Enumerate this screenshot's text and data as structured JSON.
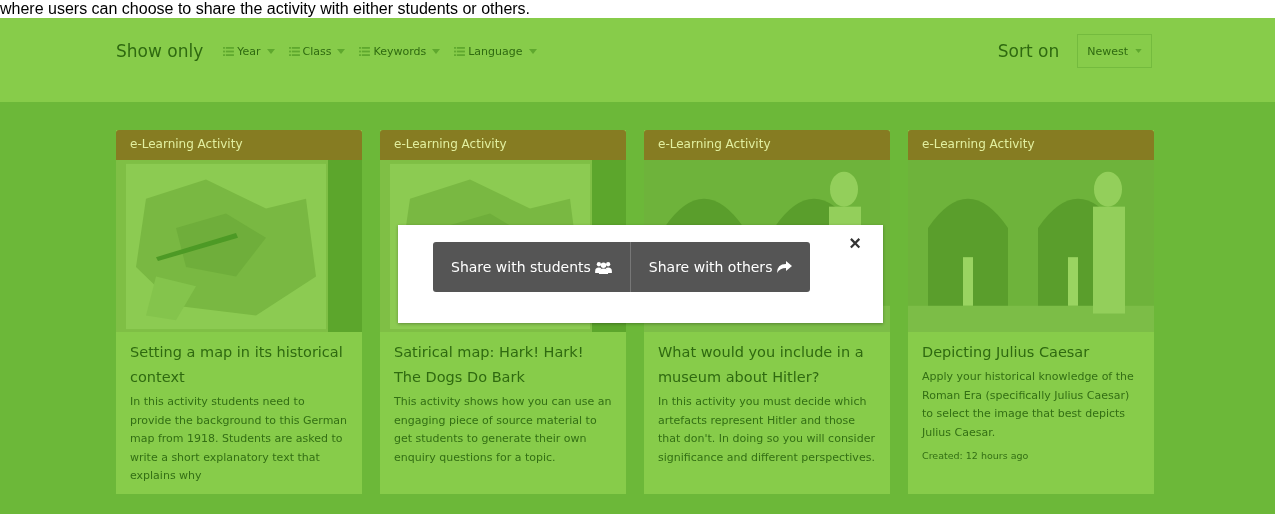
{
  "caption": "where users can choose to share the activity with either students or others.",
  "filter_bar": {
    "label": "Show only",
    "filters": [
      {
        "label": "Year"
      },
      {
        "label": "Class"
      },
      {
        "label": "Keywords"
      },
      {
        "label": "Language"
      }
    ],
    "sort_label": "Sort on",
    "sort": {
      "value": "Newest"
    }
  },
  "cards": [
    {
      "category": "e-Learning Activity",
      "title": "Setting a map in its historical context",
      "description": "In this activity students need to provide the background to this German map from 1918. Students are asked to write a short explanatory text that explains why"
    },
    {
      "category": "e-Learning Activity",
      "title": "Satirical map: Hark! Hark! The Dogs Do Bark",
      "description": "This activity shows how you can use an engaging piece of source material to get students to generate their own enquiry questions for a topic."
    },
    {
      "category": "e-Learning Activity",
      "title": "What would you include in a museum about Hitler?",
      "description": "In this activity you must decide which artefacts represent Hitler and those that don't. In doing so you will consider significance and different perspectives."
    },
    {
      "category": "e-Learning Activity",
      "title": "Depicting Julius Caesar",
      "description": "Apply your historical knowledge of the Roman Era (specifically Julius Caesar) to select the image that best depicts Julius Caesar.",
      "created": "Created: 12 hours ago"
    }
  ],
  "share_dialog": {
    "buttons": [
      {
        "label": "Share with students",
        "kind": "students"
      },
      {
        "label": "Share with others",
        "kind": "others"
      }
    ],
    "close": "×"
  }
}
